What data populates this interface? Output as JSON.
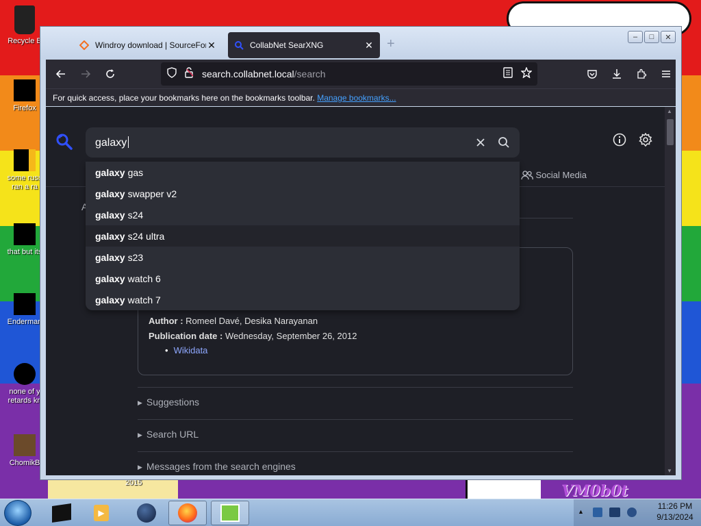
{
  "desktop": {
    "icons": [
      {
        "label": "Recycle Bin",
        "display": "Recycle B"
      },
      {
        "label": "Firefox",
        "display": "Firefox"
      },
      {
        "label": "some russ ran a ra",
        "line1": "some russ",
        "line2": "ran a ra"
      },
      {
        "label": "that but its",
        "display": "that but its"
      },
      {
        "label": "Enderman",
        "display": "Enderman"
      },
      {
        "label": "none of y retards kn",
        "line1": "none of y",
        "line2": "retards kn"
      },
      {
        "label": "ChomikB",
        "display": "ChomikB"
      }
    ],
    "wallpaper_text": "VM0b0t",
    "wallpaper_year": "2015"
  },
  "browser": {
    "tabs": [
      {
        "title": "Windroy download | SourceForge",
        "active": false
      },
      {
        "title": "CollabNet SearXNG",
        "active": true
      }
    ],
    "url": {
      "host": "search.collabnet.local",
      "path": "/search"
    },
    "bookmarks_bar": {
      "text": "For quick access, place your bookmarks here on the bookmarks toolbar.",
      "link": "Manage bookmarks..."
    }
  },
  "page": {
    "search_value": "galaxy",
    "suggestions": [
      {
        "bold": "galaxy",
        "rest": "gas"
      },
      {
        "bold": "galaxy",
        "rest": "swapper v2"
      },
      {
        "bold": "galaxy",
        "rest": "s24"
      },
      {
        "bold": "galaxy",
        "rest": "s24 ultra"
      },
      {
        "bold": "galaxy",
        "rest": "s23"
      },
      {
        "bold": "galaxy",
        "rest": "watch 6"
      },
      {
        "bold": "galaxy",
        "rest": "watch 7"
      }
    ],
    "hovered_suggestion_index": 3,
    "categories": [
      "Files",
      "Social Media"
    ],
    "category_partial": "iles",
    "left_letter": "A",
    "infobox": {
      "author_label": "Author :",
      "author_value": "Romeel Davé, Desika Narayanan",
      "date_label": "Publication date :",
      "date_value": "Wednesday, September 26, 2012",
      "link": "Wikidata"
    },
    "details": [
      "Suggestions",
      "Search URL",
      "Messages from the search engines"
    ]
  },
  "taskbar": {
    "time": "11:26 PM",
    "date": "9/13/2024"
  },
  "colors": {
    "accent": "#45a1ff",
    "page_bg": "#1e1f26",
    "searchbox_bg": "#2c2e36",
    "toolbar_bg": "#2b2a33"
  }
}
